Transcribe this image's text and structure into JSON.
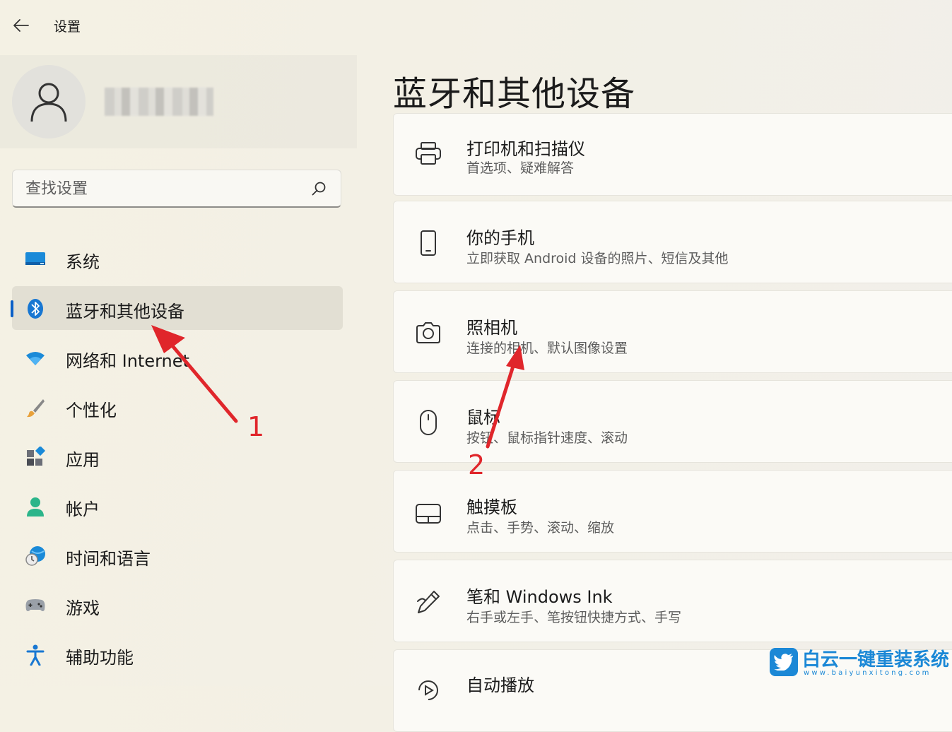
{
  "window": {
    "title": "设置"
  },
  "search": {
    "placeholder": "查找设置"
  },
  "nav": {
    "items": [
      {
        "label": "系统",
        "icon": "system-monitor-icon"
      },
      {
        "label": "蓝牙和其他设备",
        "icon": "bluetooth-icon",
        "selected": true
      },
      {
        "label": "网络和 Internet",
        "icon": "wifi-icon"
      },
      {
        "label": "个性化",
        "icon": "brush-icon"
      },
      {
        "label": "应用",
        "icon": "apps-icon"
      },
      {
        "label": "帐户",
        "icon": "account-icon"
      },
      {
        "label": "时间和语言",
        "icon": "globe-clock-icon"
      },
      {
        "label": "游戏",
        "icon": "gamepad-icon"
      },
      {
        "label": "辅助功能",
        "icon": "accessibility-icon"
      }
    ]
  },
  "main": {
    "title": "蓝牙和其他设备",
    "cards": [
      {
        "title": "打印机和扫描仪",
        "subtitle": "首选项、疑难解答",
        "icon": "printer-icon"
      },
      {
        "title": "你的手机",
        "subtitle": "立即获取 Android 设备的照片、短信及其他",
        "icon": "phone-icon"
      },
      {
        "title": "照相机",
        "subtitle": "连接的相机、默认图像设置",
        "icon": "camera-icon"
      },
      {
        "title": "鼠标",
        "subtitle": "按钮、鼠标指针速度、滚动",
        "icon": "mouse-icon"
      },
      {
        "title": "触摸板",
        "subtitle": "点击、手势、滚动、缩放",
        "icon": "touchpad-icon"
      },
      {
        "title": "笔和 Windows Ink",
        "subtitle": "右手或左手、笔按钮快捷方式、手写",
        "icon": "pen-icon"
      },
      {
        "title": "自动播放",
        "subtitle": "",
        "icon": "autoplay-icon"
      }
    ]
  },
  "annotations": {
    "one": "1",
    "two": "2",
    "arrow_color": "#e0262b"
  },
  "watermark": {
    "text": "白云一键重装系统",
    "sub": "www.baiyunxitong.com"
  },
  "colors": {
    "accent": "#0a5fc7",
    "watermark": "#1b88d6"
  }
}
